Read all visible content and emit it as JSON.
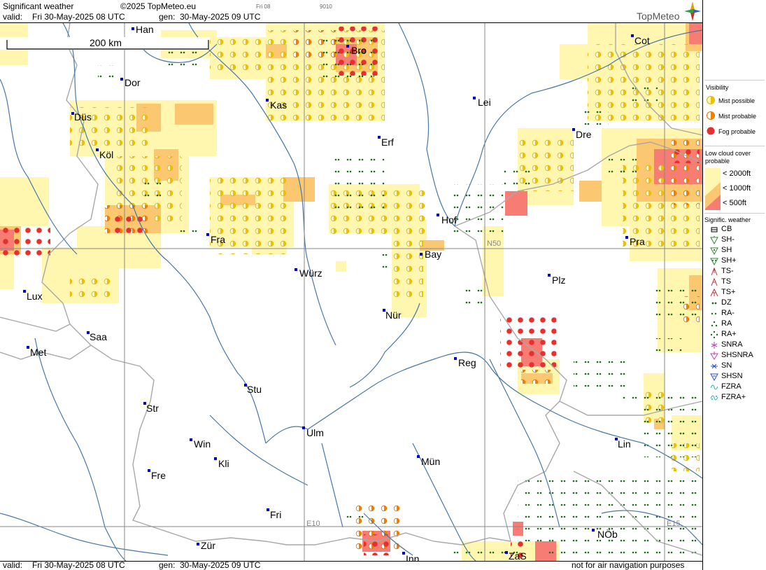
{
  "header": {
    "title": "Significant weather",
    "copyright": "©2025 TopMeteo.eu",
    "valid_label": "valid:",
    "valid_value": "Fri  30-May-2025  08 UTC",
    "gen_label": "gen:",
    "gen_value": "30-May-2025 09 UTC",
    "tiny_day": "Fri 08",
    "tiny_code": "9010",
    "brand": "TopMeteo"
  },
  "footer": {
    "valid_label": "valid:",
    "valid_value": "Fri  30-May-2025  08 UTC",
    "gen_label": "gen:",
    "gen_value": "30-May-2025 09 UTC",
    "disclaimer": "not for air navigation purposes"
  },
  "map": {
    "scale_label": "200 km",
    "grid_labels": [
      "N50",
      "E10",
      "E15"
    ],
    "cities": [
      {
        "name": "Han"
      },
      {
        "name": "Bro"
      },
      {
        "name": "Cot"
      },
      {
        "name": "Dor"
      },
      {
        "name": "Kas"
      },
      {
        "name": "Lei"
      },
      {
        "name": "Düs"
      },
      {
        "name": "Dre"
      },
      {
        "name": "Erf"
      },
      {
        "name": "Köl"
      },
      {
        "name": "Hof"
      },
      {
        "name": "Fra"
      },
      {
        "name": "Pra"
      },
      {
        "name": "Bay"
      },
      {
        "name": "Würz"
      },
      {
        "name": "Plz"
      },
      {
        "name": "Lux"
      },
      {
        "name": "Nür"
      },
      {
        "name": "Saa"
      },
      {
        "name": "Met"
      },
      {
        "name": "Reg"
      },
      {
        "name": "Stu"
      },
      {
        "name": "Str"
      },
      {
        "name": "Ulm"
      },
      {
        "name": "Lin"
      },
      {
        "name": "Win"
      },
      {
        "name": "Kli"
      },
      {
        "name": "Mün"
      },
      {
        "name": "Fre"
      },
      {
        "name": "Fri"
      },
      {
        "name": "NÖb"
      },
      {
        "name": "Zür"
      },
      {
        "name": "ZaS"
      },
      {
        "name": "Inn"
      }
    ]
  },
  "legend": {
    "visibility_title": "Visibility",
    "visibility_items": [
      "Mist possible",
      "Mist probable",
      "Fog probable"
    ],
    "lowcloud_title_1": "Low cloud cover",
    "lowcloud_title_2": "probable",
    "lowcloud_items": [
      "< 2000ft",
      "< 1000ft",
      "<   500ft"
    ],
    "sigwx_title": "Signific. weather",
    "sigwx_items": [
      "CB",
      "SH-",
      "SH",
      "SH+",
      "TS-",
      "TS",
      "TS+",
      "DZ",
      "RA-",
      "RA",
      "RA+",
      "SNRA",
      "SHSNRA",
      "SN",
      "SHSN",
      "FZRA",
      "FZRA+"
    ]
  },
  "colors": {
    "low_cloud_2000": "#fff6b0",
    "low_cloud_1000": "#fbc770",
    "low_cloud_500": "#f77c74",
    "fog": "#e53030",
    "mist": "#f0c000",
    "drizzle": "#1e6b1e",
    "river": "#4678a8",
    "border": "#a8a8a8",
    "city": "#0000cc"
  }
}
